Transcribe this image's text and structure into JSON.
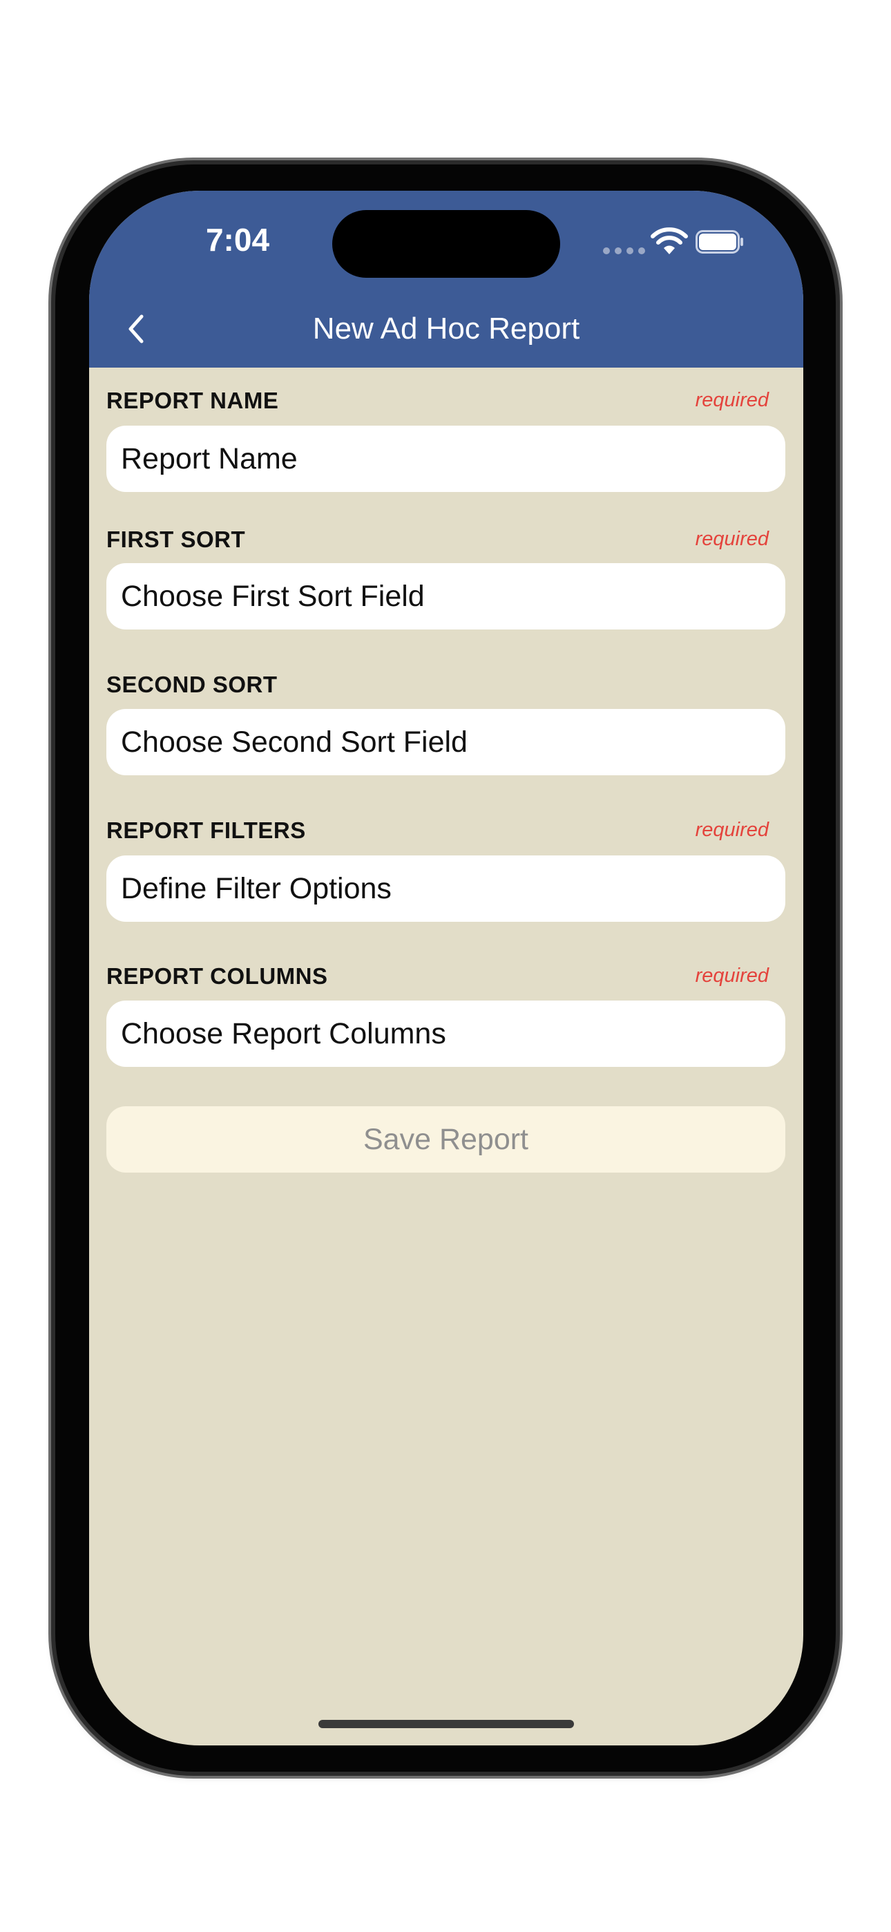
{
  "status_bar": {
    "time": "7:04"
  },
  "nav": {
    "title": "New Ad Hoc Report",
    "back_icon": "chevron-left-icon"
  },
  "form": {
    "report_name": {
      "label": "REPORT NAME",
      "required": "required",
      "placeholder": "Report Name"
    },
    "first_sort": {
      "label": "FIRST SORT",
      "required": "required",
      "value": "Choose First Sort Field"
    },
    "second_sort": {
      "label": "SECOND SORT",
      "value": "Choose Second Sort Field"
    },
    "report_filters": {
      "label": "REPORT FILTERS",
      "required": "required",
      "value": "Define Filter Options"
    },
    "report_columns": {
      "label": "REPORT COLUMNS",
      "required": "required",
      "value": "Choose Report Columns"
    },
    "save_label": "Save Report"
  },
  "colors": {
    "header": "#3d5b96",
    "background": "#e2ddc8",
    "required": "#e4433c",
    "save_button": "#faf4e1"
  }
}
